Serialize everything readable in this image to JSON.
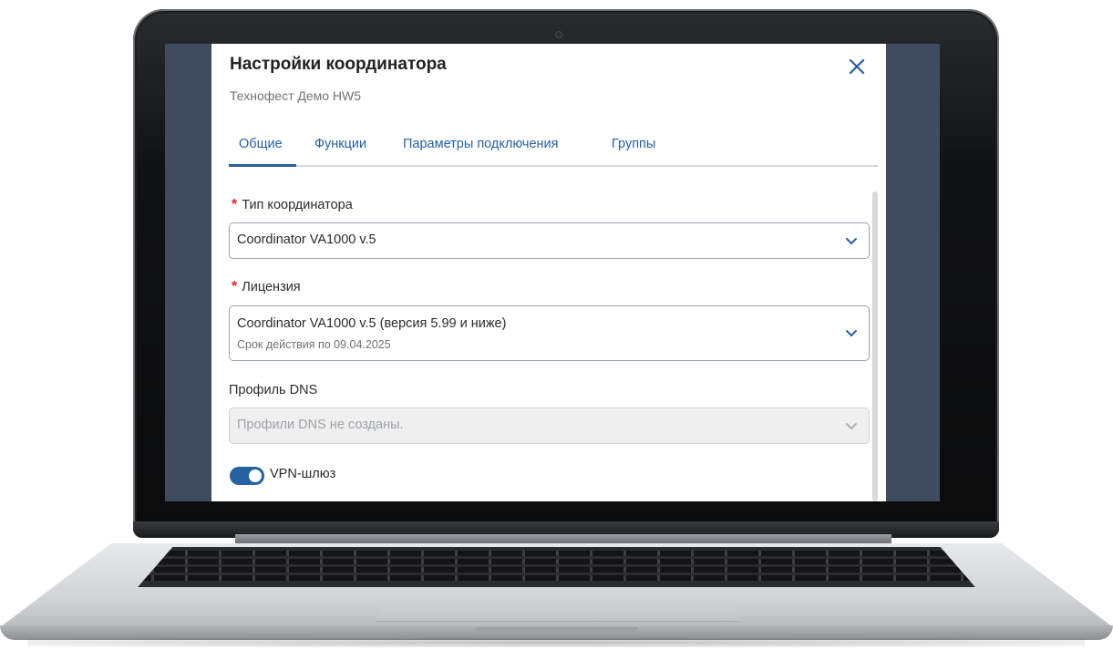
{
  "dialog": {
    "title": "Настройки координатора",
    "subtitle": "Технофест Демо HW5"
  },
  "tabs": [
    {
      "label": "Общие",
      "active": true
    },
    {
      "label": "Функции",
      "active": false
    },
    {
      "label": "Параметры подключения",
      "active": false
    },
    {
      "label": "Группы",
      "active": false
    }
  ],
  "fields": {
    "coordinator_type": {
      "required_mark": "*",
      "label": "Тип координатора",
      "value": "Coordinator VA1000 v.5"
    },
    "license": {
      "required_mark": "*",
      "label": "Лицензия",
      "value": "Coordinator VA1000 v.5 (версия 5.99 и ниже)",
      "detail": "Срок действия по 09.04.2025"
    },
    "dns_profile": {
      "label": "Профиль DNS",
      "value": "Профили DNS не созданы.",
      "disabled": true
    },
    "vpn_gateway": {
      "label": "VPN-шлюз",
      "enabled": true
    }
  },
  "colors": {
    "accent": "#27619e",
    "required": "#d8262c",
    "backdrop": "#3f4b5e"
  }
}
